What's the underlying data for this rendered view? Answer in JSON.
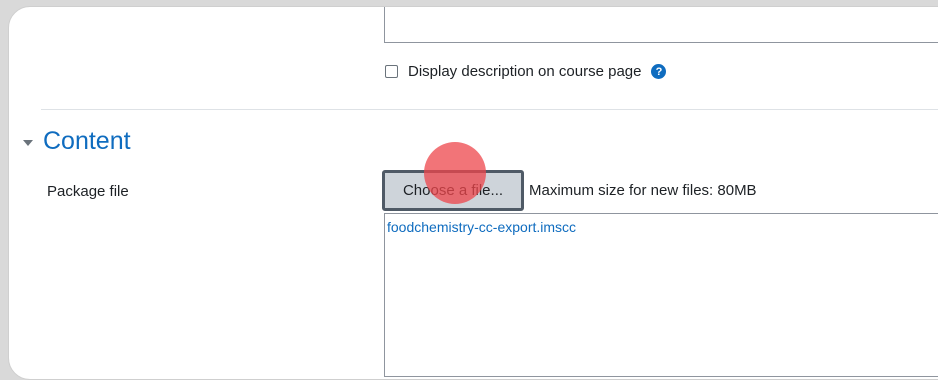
{
  "description": {
    "checkbox_label": "Display description on course page",
    "help_icon": "question-circle-icon"
  },
  "content_section": {
    "title": "Content",
    "collapse_icon": "caret-down-icon"
  },
  "package_file": {
    "label": "Package file",
    "choose_button_label": "Choose a file...",
    "max_size_text": "Maximum size for new files: 80MB",
    "files": [
      "foodchemistry-cc-export.imscc"
    ]
  },
  "colors": {
    "link": "#0f6cbf",
    "button_bg": "#ced4da",
    "click_indicator": "#ee464b"
  }
}
